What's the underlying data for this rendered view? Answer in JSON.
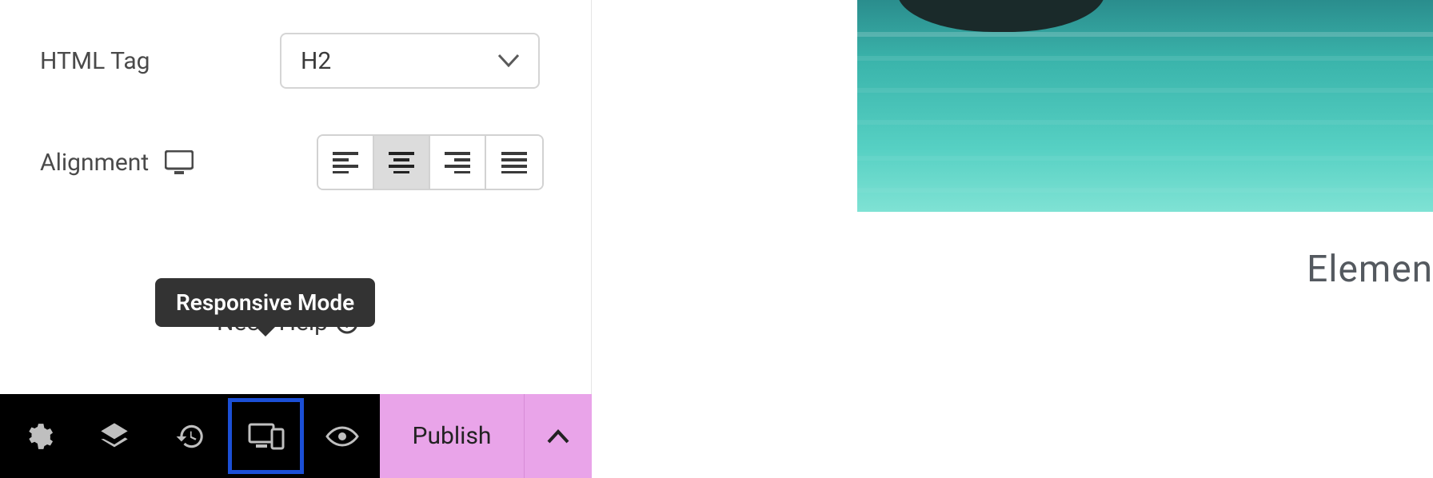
{
  "controls": {
    "html_tag": {
      "label": "HTML Tag",
      "value": "H2"
    },
    "alignment": {
      "label": "Alignment",
      "options": [
        "left",
        "center",
        "right",
        "justify"
      ],
      "selected": "center"
    }
  },
  "help": {
    "label": "Need Help"
  },
  "tooltip": {
    "responsive_mode": "Responsive Mode"
  },
  "bottom_bar": {
    "icons": [
      "settings",
      "navigator",
      "history",
      "responsive",
      "preview"
    ],
    "publish_label": "Publish"
  },
  "preview": {
    "heading_partial": "Elemen"
  }
}
